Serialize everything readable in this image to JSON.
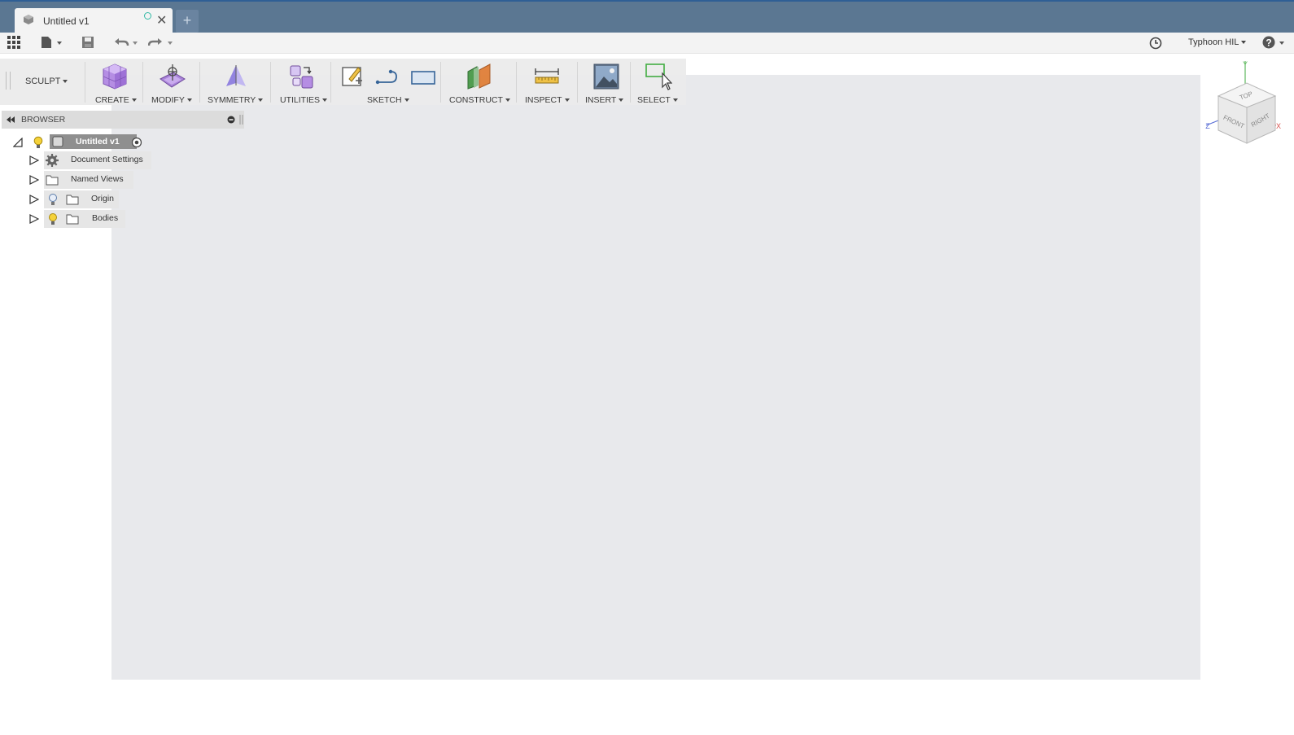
{
  "window": {
    "tab_title": "Untitled v1",
    "new_tab_symbol": "+",
    "close_symbol": "✕"
  },
  "quick_access": {
    "user_name": "Typhoon HIL",
    "icons": [
      "apps-grid-icon",
      "file-menu-icon",
      "save-icon",
      "undo-icon",
      "redo-icon",
      "job-status-clock-icon",
      "help-icon"
    ]
  },
  "toolbar": {
    "workspace": "SCULPT",
    "groups": [
      {
        "label": "CREATE",
        "icon": "create-box-icon"
      },
      {
        "label": "MODIFY",
        "icon": "modify-icon"
      },
      {
        "label": "SYMMETRY",
        "icon": "symmetry-icon"
      },
      {
        "label": "UTILITIES",
        "icon": "utilities-icon"
      },
      {
        "label": "SKETCH",
        "icon": "sketch-icons"
      },
      {
        "label": "CONSTRUCT",
        "icon": "construct-plane-icon"
      },
      {
        "label": "INSPECT",
        "icon": "measure-icon"
      },
      {
        "label": "INSERT",
        "icon": "insert-image-icon"
      },
      {
        "label": "SELECT",
        "icon": "select-icon"
      }
    ]
  },
  "browser": {
    "title": "BROWSER",
    "root": "Untitled v1",
    "items": [
      {
        "label": "Document Settings",
        "icon": "gear-icon"
      },
      {
        "label": "Named Views",
        "icon": "folder-icon"
      },
      {
        "label": "Origin",
        "icon": "folder-icon"
      },
      {
        "label": "Bodies",
        "icon": "folder-icon"
      }
    ]
  },
  "viewcube": {
    "faces": {
      "top": "TOP",
      "front": "FRONT",
      "right": "RIGHT"
    },
    "axes": {
      "x": "X",
      "y": "Y",
      "z": "Z"
    },
    "colors": {
      "x": "#d9534f",
      "y": "#5cb85c",
      "z": "#5b6fd6"
    }
  },
  "colors": {
    "titlebar": "#5b7792",
    "canvas": "#e8e9ec",
    "sync_dot": "#32b9a5",
    "create_purple": "#9b6dd6"
  }
}
